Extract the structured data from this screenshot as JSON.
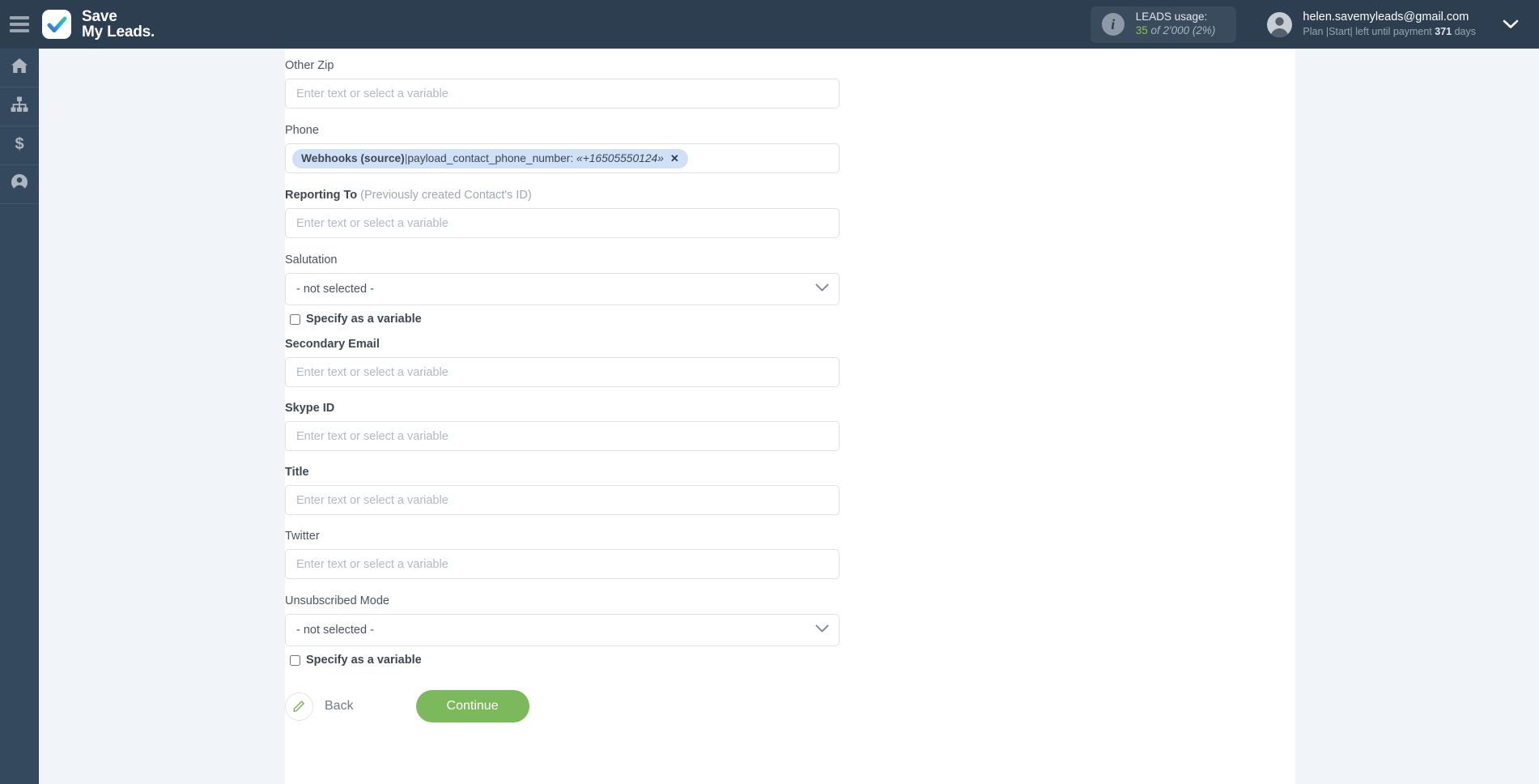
{
  "header": {
    "menu_icon": "hamburger-icon",
    "brand_line1": "Save",
    "brand_line2": "My Leads.",
    "usage": {
      "icon": "info-icon",
      "title": "LEADS usage:",
      "used": "35",
      "of_total": "of 2'000",
      "percent": "(2%)",
      "accent_color": "#8bc34a"
    },
    "account": {
      "avatar_icon": "user-avatar-icon",
      "email": "helen.savemyleads@gmail.com",
      "plan_prefix": "Plan |Start| left until payment",
      "days_value": "371",
      "days_suffix": "days",
      "chevron_icon": "chevron-down-icon"
    }
  },
  "sidebar": {
    "items": [
      {
        "name": "home",
        "icon": "home-icon"
      },
      {
        "name": "connections",
        "icon": "sitemap-icon"
      },
      {
        "name": "billing",
        "icon": "dollar-icon"
      },
      {
        "name": "account",
        "icon": "user-circle-icon"
      }
    ]
  },
  "form": {
    "placeholder": "Enter text or select a variable",
    "not_selected": "- not selected -",
    "specify_as_variable": "Specify as a variable",
    "fields": [
      {
        "id": "other-zip",
        "label": "Other Zip",
        "hint": "",
        "type": "text"
      },
      {
        "id": "phone",
        "label": "Phone",
        "hint": "",
        "type": "chip"
      },
      {
        "id": "reporting-to",
        "label": "Reporting To",
        "hint": "(Previously created Contact's ID)",
        "type": "text"
      },
      {
        "id": "salutation",
        "label": "Salutation",
        "hint": "",
        "type": "select"
      },
      {
        "id": "secondary-email",
        "label": "Secondary Email",
        "hint": "",
        "type": "text"
      },
      {
        "id": "skype-id",
        "label": "Skype ID",
        "hint": "",
        "type": "text"
      },
      {
        "id": "title",
        "label": "Title",
        "hint": "",
        "type": "text"
      },
      {
        "id": "twitter",
        "label": "Twitter",
        "hint": "",
        "type": "text"
      },
      {
        "id": "unsubscribed-mode",
        "label": "Unsubscribed Mode",
        "hint": "",
        "type": "select"
      }
    ],
    "phone_chip": {
      "source": "Webhooks (source)",
      "separator": " | ",
      "variable": "payload_contact_phone_number:",
      "value": "«+16505550124»",
      "remove_icon": "close-icon",
      "bg_color": "#cfe0f7"
    }
  },
  "actions": {
    "back_label": "Back",
    "back_icon": "pencil-icon",
    "continue_label": "Continue",
    "continue_color": "#7cb85c"
  }
}
